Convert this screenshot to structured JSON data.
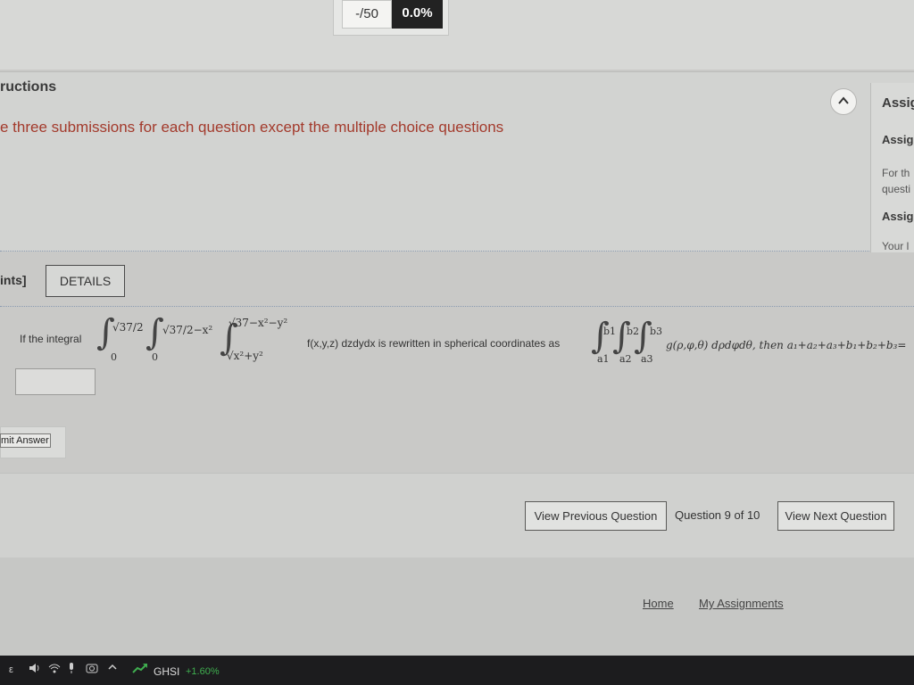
{
  "score": {
    "value": "-/50",
    "percent": "0.0%"
  },
  "instructions": {
    "title": "ructions",
    "text": "e three submissions for each question except the multiple choice questions"
  },
  "right_panel": {
    "heading": "Assig",
    "items": [
      {
        "title": "Assig",
        "text_lines": [
          "For th",
          "questi"
        ]
      },
      {
        "title": "Assig",
        "text_lines": [
          "Your l"
        ]
      }
    ]
  },
  "question": {
    "points_label": "ints]",
    "details_label": "DETAILS",
    "intro": "If the integral",
    "limits": {
      "outer_upper": "√37/2",
      "outer_lower": "0",
      "middle_upper": "√37/2−x²",
      "middle_lower": "0",
      "inner_upper": "√37−x²−y²",
      "inner_lower": "√x²+y²"
    },
    "integrand": "f(x,y,z) dzdydx is rewritten in spherical coordinates as",
    "spherical_limits": {
      "b1": "b1",
      "b2": "b2",
      "b3": "b3",
      "a1": "a1",
      "a2": "a2",
      "a3": "a3"
    },
    "spherical_integrand": "g(ρ,φ,θ) dρdφdθ, then a₁+a₂+a₃+b₁+b₂+b₃=",
    "answer_value": ""
  },
  "submit_label": "mit Answer",
  "navigation": {
    "previous": "View Previous Question",
    "counter": "Question 9 of 10",
    "next": "View Next Question"
  },
  "footer": {
    "home": "Home",
    "assignments": "My Assignments"
  },
  "taskbar": {
    "ticker": "GHSI",
    "change": "+1.60%",
    "lang": "ε"
  },
  "colors": {
    "instruction_text": "#a33a2c",
    "score_badge": "#222222",
    "ticker_up": "#3fae4f"
  }
}
